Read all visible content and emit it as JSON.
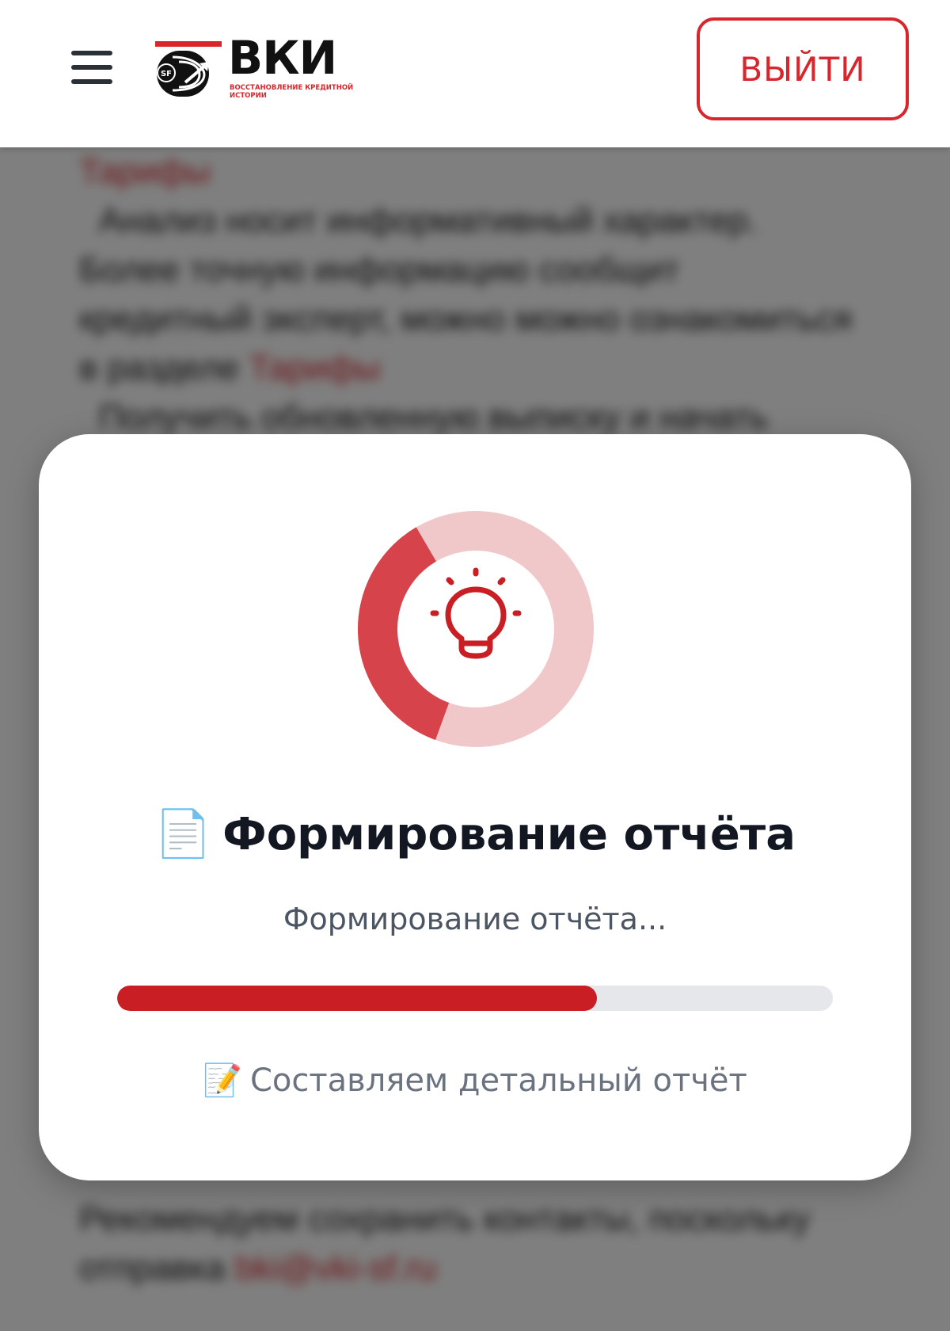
{
  "header": {
    "logo_text": "ВКИ",
    "logo_badge": "SF",
    "logo_subtitle": "ВОССТАНОВЛЕНИЕ КРЕДИТНОЙ ИСТОРИИ",
    "logout_label": "ВЫЙТИ"
  },
  "background": {
    "link_1": "Тарифы",
    "paragraph_1": "Анализ носит информативный характер. Более точную информацию сообщит кредитный эксперт, можно можно ознакомиться в разделе",
    "link_2": "Тарифы",
    "line_2": "Получить обновленную выписку и начать",
    "paragraph_bottom": "Рекомендуем сохранить контакты, поскольку отправка",
    "link_bottom": "bki@vki-sf.ru"
  },
  "modal": {
    "title_emoji": "📄",
    "title": "Формирование отчёта",
    "subtitle": "Формирование отчёта...",
    "progress": 0.67,
    "step_emoji": "📝",
    "step_text": "Составляем детальный отчёт",
    "ring_fraction": 0.36
  },
  "colors": {
    "brand_red": "#d8262c",
    "progress_fill": "#c81e24",
    "progress_track": "#e5e7eb",
    "ring_light": "#f1c8ca",
    "ring_dark": "#d6434a"
  },
  "icons": {
    "menu": "hamburger-icon",
    "loader": "lightbulb-icon"
  }
}
